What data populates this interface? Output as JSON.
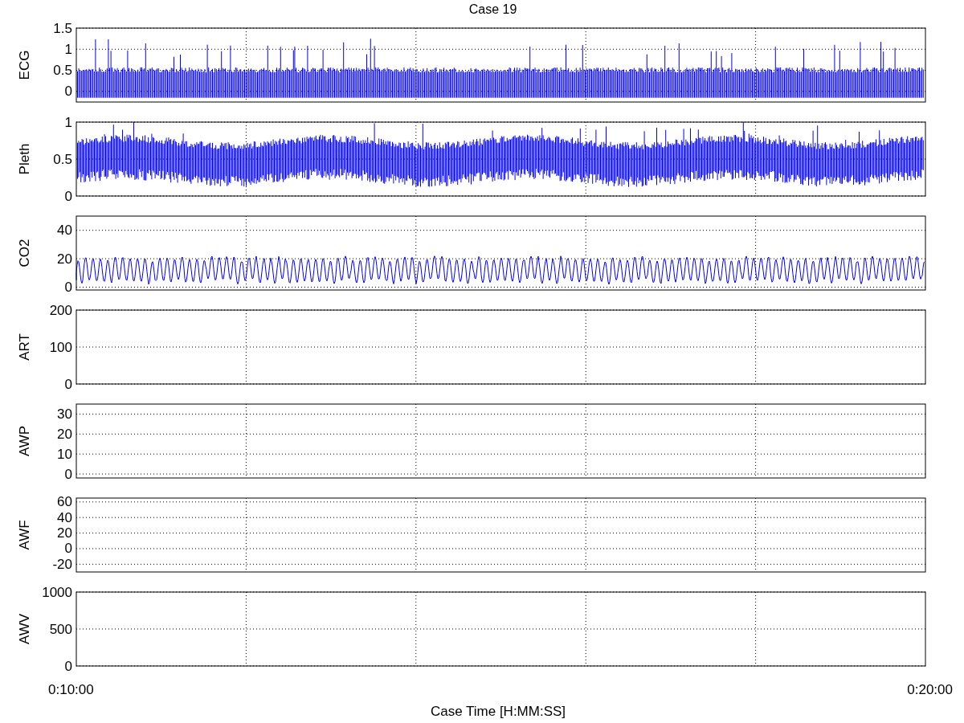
{
  "title": "Case 19",
  "panels": [
    {
      "kind": "ecg",
      "ylabel": "ECG",
      "yticks": [
        "1.5",
        "1",
        "0.5",
        "0"
      ]
    },
    {
      "kind": "pleth",
      "ylabel": "Pleth",
      "yticks": [
        "1",
        "0.5",
        "0"
      ]
    },
    {
      "kind": "co2",
      "ylabel": "CO2",
      "yticks": [
        "40",
        "20",
        "0"
      ]
    },
    {
      "kind": "flat",
      "ylabel": "ART",
      "yticks": [
        "200",
        "100",
        "0"
      ]
    },
    {
      "kind": "flat",
      "ylabel": "AWP",
      "yticks": [
        "30",
        "20",
        "10",
        "0"
      ]
    },
    {
      "kind": "flat",
      "ylabel": "AWF",
      "yticks": [
        "60",
        "40",
        "20",
        "0",
        "-20"
      ]
    },
    {
      "kind": "flat",
      "ylabel": "AWV",
      "yticks": [
        "1000",
        "500",
        "0"
      ]
    }
  ],
  "x_axis": {
    "ticks": [
      "0:10:00",
      "0:20:00"
    ],
    "label": "Case Time [H:MM:SS]"
  }
}
